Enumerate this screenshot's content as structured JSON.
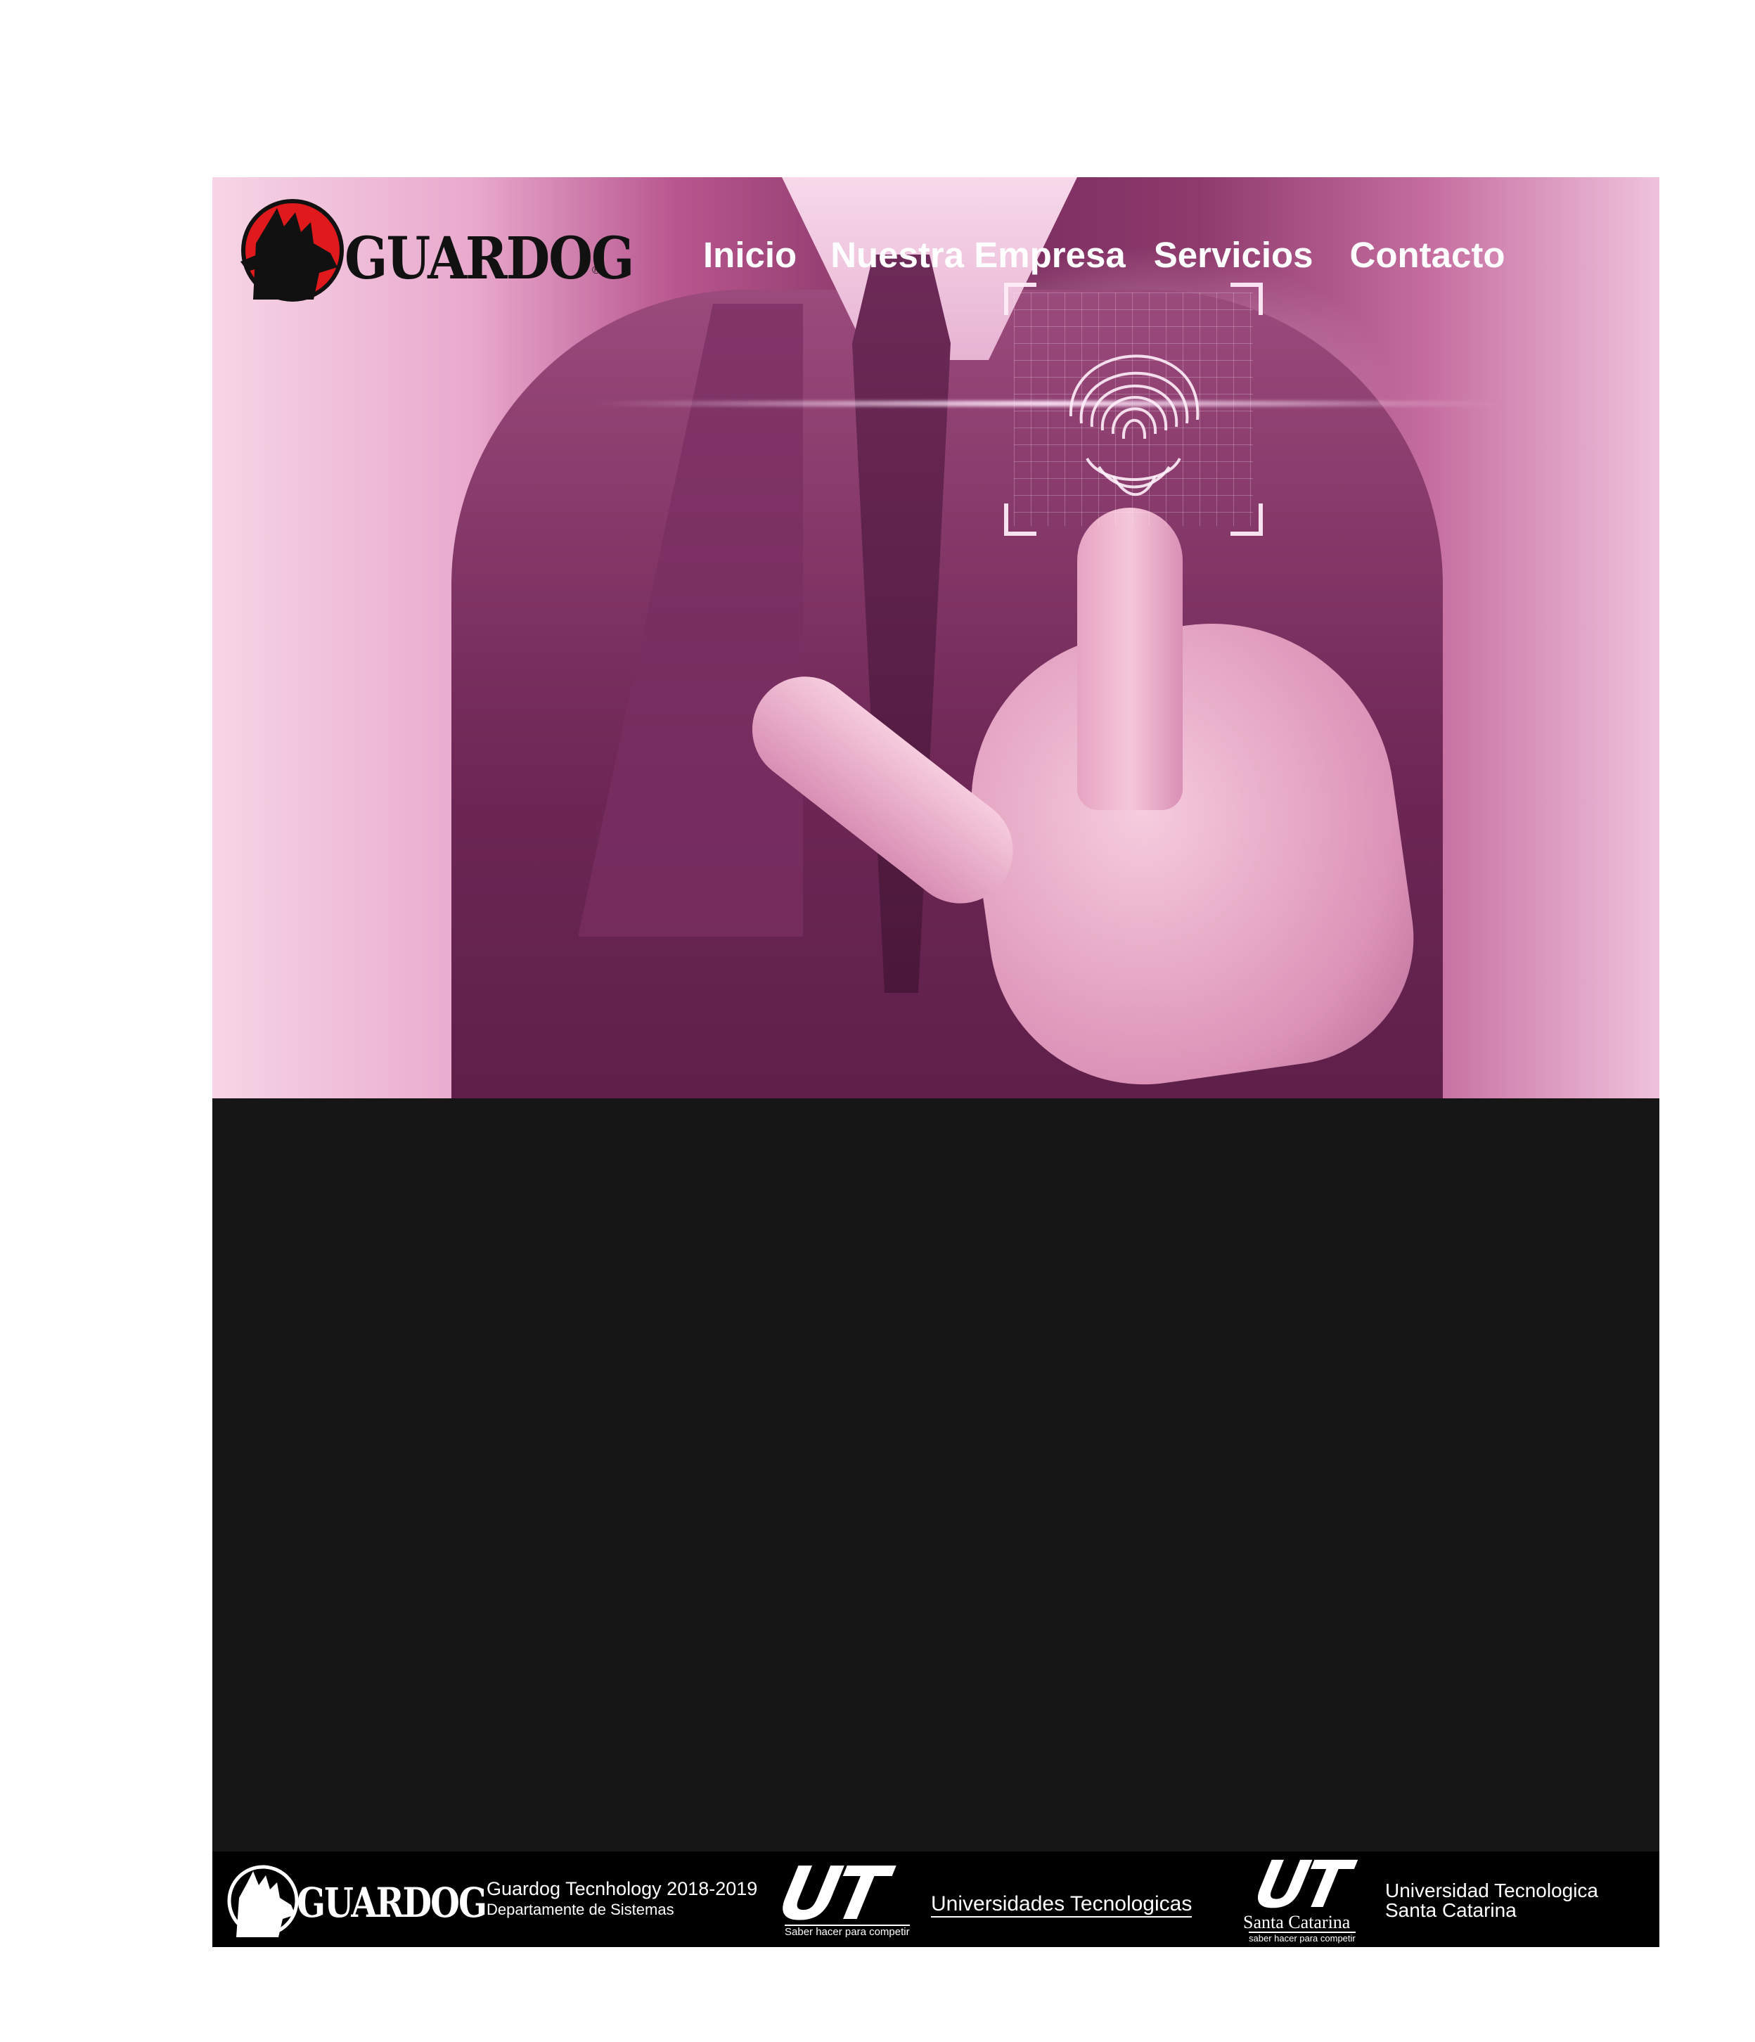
{
  "header": {
    "brand": "GUARDOG",
    "nav": [
      {
        "label": "Inicio"
      },
      {
        "label": "Nuestra Empresa"
      },
      {
        "label": "Servicios"
      },
      {
        "label": "Contacto"
      }
    ]
  },
  "colors": {
    "hero_tint": "#c46a9e",
    "content_bg": "#161616",
    "footer_bg": "#000000",
    "logo_red": "#e0191c",
    "nav_text": "#ffffff"
  },
  "footer": {
    "brand": "GUARDOG",
    "company_line1": "Guardog Tecnhology 2018-2019",
    "company_line2": "Departamente de Sistemas",
    "ut_logo": "UT",
    "ut_name": "Universidades Tecnologicas",
    "ut_slogan": "Saber hacer para competir",
    "utsc_logo": "UT",
    "utsc_campus": "Santa Catarina",
    "utsc_slogan": "saber hacer para competir",
    "utsc_name_line1": "Universidad Tecnologica",
    "utsc_name_line2": "Santa Catarina"
  }
}
